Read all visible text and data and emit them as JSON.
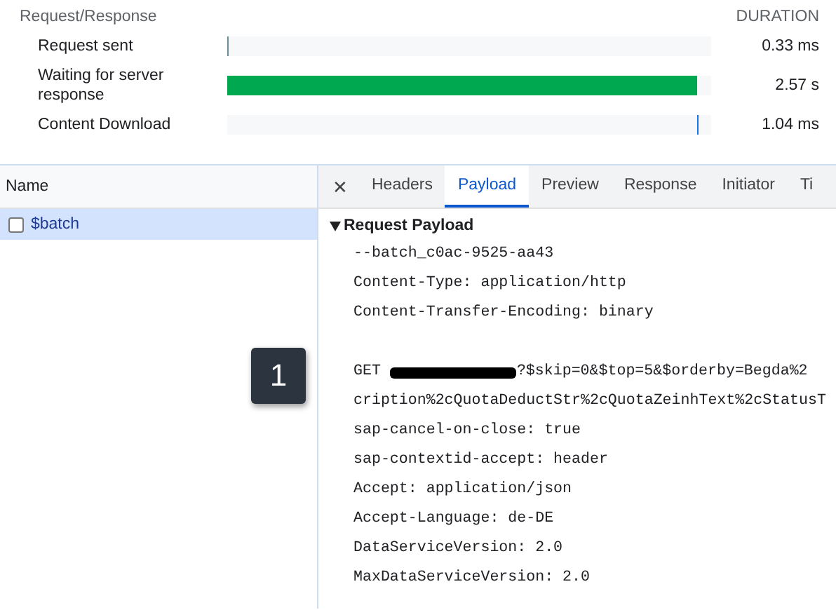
{
  "timing": {
    "heading": "Request/Response",
    "duration_heading": "DURATION",
    "rows": [
      {
        "label": "Request sent",
        "kind": "start-tick",
        "duration": "0.33 ms"
      },
      {
        "label": "Waiting for server response",
        "kind": "bar",
        "level": 0.97,
        "duration": "2.57 s"
      },
      {
        "label": "Content Download",
        "kind": "end-tick",
        "duration": "1.04 ms"
      }
    ]
  },
  "requests": {
    "column": "Name",
    "rows": [
      {
        "name": "$batch",
        "selected": true,
        "checked": false
      }
    ]
  },
  "close": "✕",
  "tabs": [
    {
      "label": "Headers",
      "selected": false
    },
    {
      "label": "Payload",
      "selected": true
    },
    {
      "label": "Preview",
      "selected": false
    },
    {
      "label": "Response",
      "selected": false
    },
    {
      "label": "Initiator",
      "selected": false
    },
    {
      "label": "Ti",
      "selected": false
    }
  ],
  "payload": {
    "heading": "Request Payload",
    "expanded": true,
    "lines": [
      {
        "kind": "text",
        "text": "--batch_c0ac-9525-aa43"
      },
      {
        "kind": "text",
        "text": "Content-Type: application/http"
      },
      {
        "kind": "text",
        "text": "Content-Transfer-Encoding: binary"
      },
      {
        "kind": "blank"
      },
      {
        "kind": "redacted",
        "before": "GET",
        "after": "?$skip=0&$top=5&$orderby=Begda%2"
      },
      {
        "kind": "text",
        "text": "cription%2cQuotaDeductStr%2cQuotaZeinhText%2cStatusT"
      },
      {
        "kind": "text",
        "text": "sap-cancel-on-close: true"
      },
      {
        "kind": "text",
        "text": "sap-contextid-accept: header"
      },
      {
        "kind": "text",
        "text": "Accept: application/json"
      },
      {
        "kind": "text",
        "text": "Accept-Language: de-DE"
      },
      {
        "kind": "text",
        "text": "DataServiceVersion: 2.0"
      },
      {
        "kind": "text",
        "text": "MaxDataServiceVersion: 2.0"
      }
    ]
  },
  "badge": "1"
}
